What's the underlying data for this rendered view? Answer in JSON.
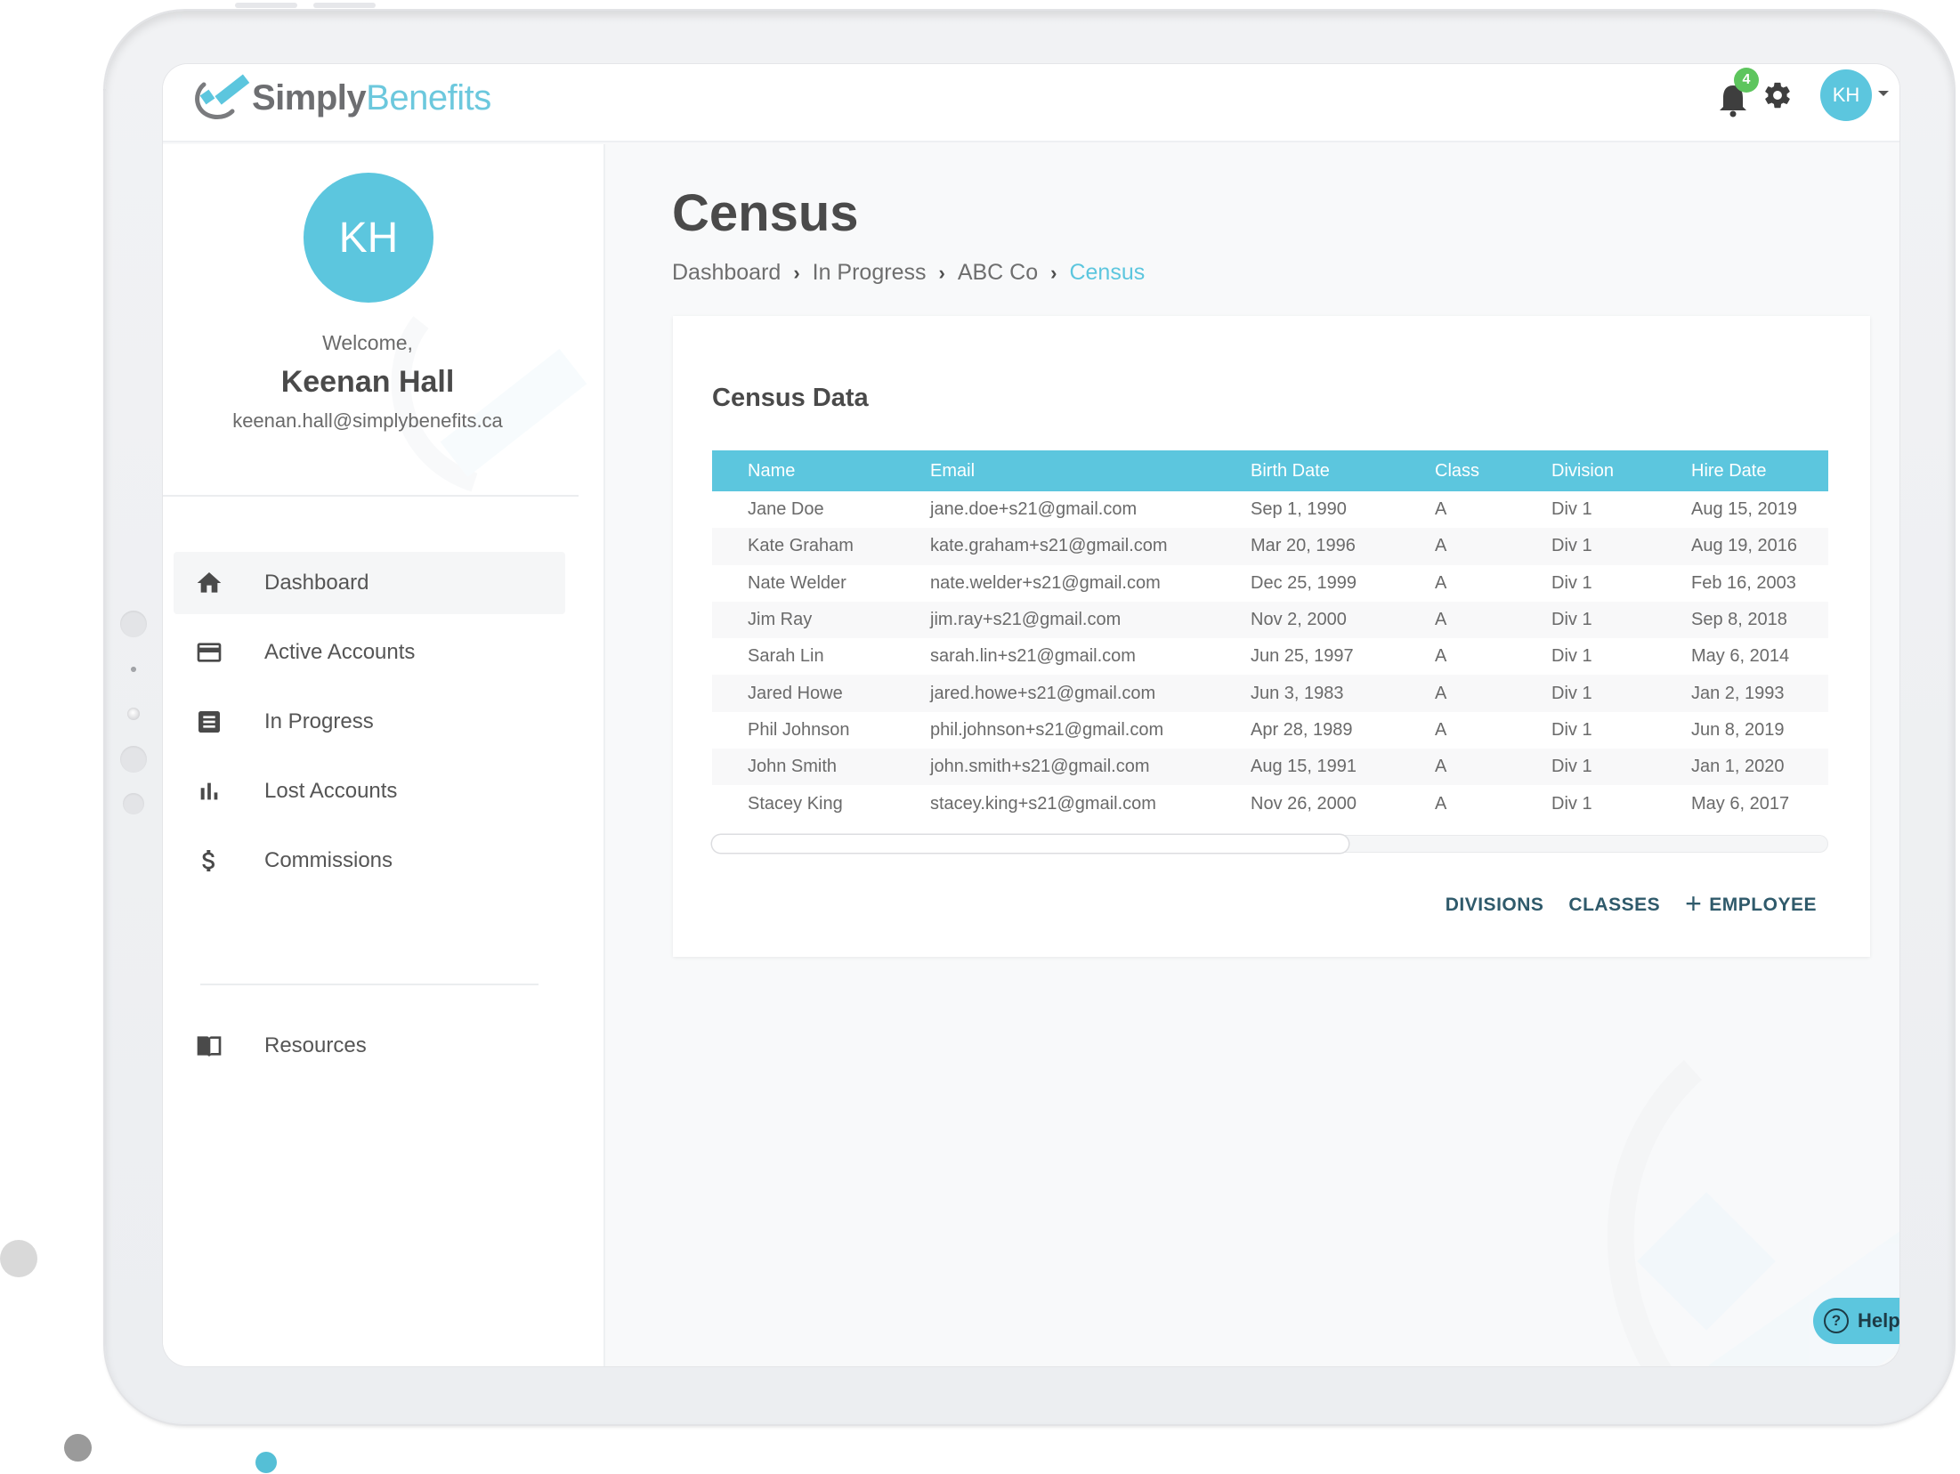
{
  "app": {
    "brand_primary": "Simply",
    "brand_secondary": "Benefits",
    "accent_color": "#5cc6de",
    "badge_color": "#5dc55d"
  },
  "header": {
    "notification_count": "4",
    "user_initials": "KH",
    "icons": [
      "bell-icon",
      "gear-icon",
      "caret-down-icon"
    ]
  },
  "profile": {
    "initials": "KH",
    "welcome": "Welcome,",
    "name": "Keenan Hall",
    "email": "keenan.hall@simplybenefits.ca"
  },
  "sidebar": {
    "items": [
      {
        "label": "Dashboard",
        "icon": "home-icon",
        "active": true
      },
      {
        "label": "Active Accounts",
        "icon": "credit-card-icon",
        "active": false
      },
      {
        "label": "In Progress",
        "icon": "list-document-icon",
        "active": false
      },
      {
        "label": "Lost Accounts",
        "icon": "bar-chart-icon",
        "active": false
      },
      {
        "label": "Commissions",
        "icon": "dollar-icon",
        "active": false
      }
    ],
    "secondary": [
      {
        "label": "Resources",
        "icon": "book-icon"
      }
    ]
  },
  "page": {
    "title": "Census",
    "breadcrumb": [
      "Dashboard",
      "In Progress",
      "ABC Co",
      "Census"
    ]
  },
  "census": {
    "title": "Census Data",
    "columns": [
      "Name",
      "Email",
      "Birth Date",
      "Class",
      "Division",
      "Hire Date"
    ],
    "rows": [
      [
        "Jane Doe",
        "jane.doe+s21@gmail.com",
        "Sep 1, 1990",
        "A",
        "Div 1",
        "Aug 15, 2019"
      ],
      [
        "Kate Graham",
        "kate.graham+s21@gmail.com",
        "Mar 20, 1996",
        "A",
        "Div 1",
        "Aug 19, 2016"
      ],
      [
        "Nate Welder",
        "nate.welder+s21@gmail.com",
        "Dec 25, 1999",
        "A",
        "Div 1",
        "Feb 16, 2003"
      ],
      [
        "Jim Ray",
        "jim.ray+s21@gmail.com",
        "Nov 2, 2000",
        "A",
        "Div 1",
        "Sep 8, 2018"
      ],
      [
        "Sarah Lin",
        "sarah.lin+s21@gmail.com",
        "Jun 25, 1997",
        "A",
        "Div 1",
        "May 6, 2014"
      ],
      [
        "Jared Howe",
        "jared.howe+s21@gmail.com",
        "Jun 3, 1983",
        "A",
        "Div 1",
        "Jan 2, 1993"
      ],
      [
        "Phil Johnson",
        "phil.johnson+s21@gmail.com",
        "Apr 28, 1989",
        "A",
        "Div 1",
        "Jun 8, 2019"
      ],
      [
        "John Smith",
        "john.smith+s21@gmail.com",
        "Aug 15, 1991",
        "A",
        "Div 1",
        "Jan 1, 2020"
      ],
      [
        "Stacey King",
        "stacey.king+s21@gmail.com",
        "Nov 26, 2000",
        "A",
        "Div 1",
        "May 6, 2017"
      ]
    ],
    "horizontal_scroll_visible_fraction": 0.57,
    "actions": {
      "divisions": "DIVISIONS",
      "classes": "CLASSES",
      "add_employee": "EMPLOYEE",
      "add_symbol": "+"
    }
  },
  "help": {
    "label": "Help",
    "icon_glyph": "?"
  }
}
